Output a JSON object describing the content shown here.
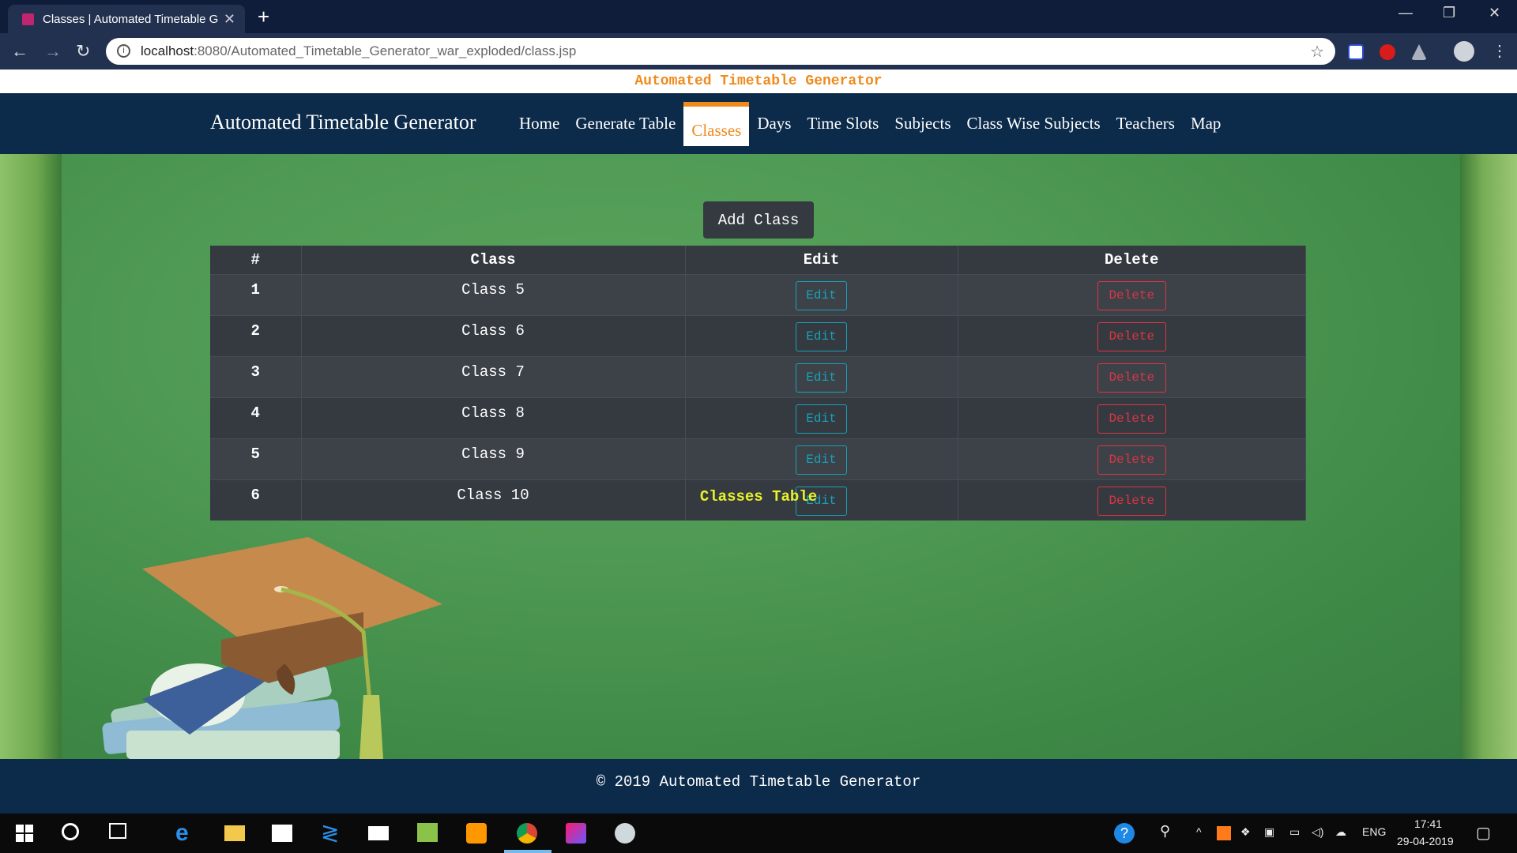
{
  "browser": {
    "tab_title": "Classes | Automated Timetable G",
    "url_host": "localhost",
    "url_rest": ":8080/Automated_Timetable_Generator_war_exploded/class.jsp"
  },
  "banner": "Automated Timetable Generator",
  "nav": {
    "brand": "Automated Timetable Generator",
    "links": [
      "Home",
      "Generate Table",
      "Classes",
      "Days",
      "Time Slots",
      "Subjects",
      "Class Wise Subjects",
      "Teachers",
      "Map"
    ],
    "active": "Classes"
  },
  "add_button": "Add Class",
  "table": {
    "headers": [
      "#",
      "Class",
      "Edit",
      "Delete"
    ],
    "rows": [
      {
        "num": "1",
        "name": "Class 5"
      },
      {
        "num": "2",
        "name": "Class 6"
      },
      {
        "num": "3",
        "name": "Class 7"
      },
      {
        "num": "4",
        "name": "Class 8"
      },
      {
        "num": "5",
        "name": "Class 9"
      },
      {
        "num": "6",
        "name": "Class 10"
      }
    ],
    "edit_label": "Edit",
    "delete_label": "Delete",
    "caption": "Classes Table"
  },
  "footer": "2019 Automated Timetable Generator",
  "taskbar": {
    "lang": "ENG",
    "time": "17:41",
    "date": "29-04-2019"
  }
}
